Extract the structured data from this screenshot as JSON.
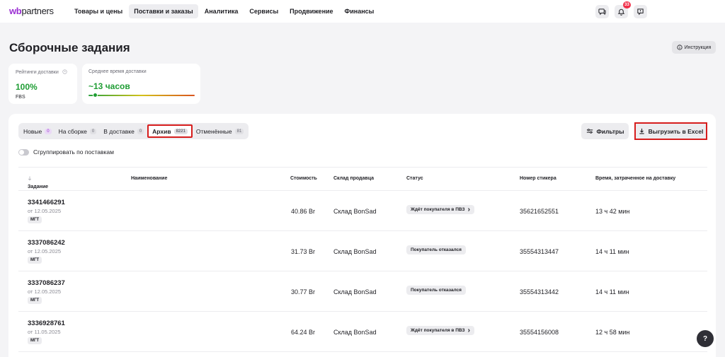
{
  "brand": {
    "wb": "wb",
    "partners": "partners"
  },
  "nav": [
    "Товары и цены",
    "Поставки и заказы",
    "Аналитика",
    "Сервисы",
    "Продвижение",
    "Финансы"
  ],
  "nav_active": "Поставки и заказы",
  "header_icons": {
    "chat": "chat-icon",
    "bell": "bell-icon",
    "bell_badge": "33",
    "feedback": "feedback-icon"
  },
  "page": {
    "title": "Сборочные задания",
    "instruction_label": "Инструкция"
  },
  "rating_card": {
    "label": "Рейтинги доставки",
    "value": "100%",
    "sub": "FBS"
  },
  "delivery_card": {
    "label": "Среднее время доставки",
    "value": "~13 часов"
  },
  "tabs": [
    {
      "label": "Новые",
      "count": "0"
    },
    {
      "label": "На сборке",
      "count": "0"
    },
    {
      "label": "В доставке",
      "count": "0"
    },
    {
      "label": "Архив",
      "count": "8221"
    },
    {
      "label": "Отменённые",
      "count": "81"
    }
  ],
  "active_tab": "Архив",
  "buttons": {
    "filters": "Фильтры",
    "export": "Выгрузить в Excel"
  },
  "group_toggle": "Сгруппировать по поставкам",
  "columns": {
    "task": "Задание",
    "name": "Наименование",
    "price": "Стоимость",
    "warehouse": "Склад продавца",
    "status": "Статус",
    "sticker": "Номер стикера",
    "time": "Время, затраченное на доставку"
  },
  "rows": [
    {
      "id": "3341466291",
      "date": "от 12.05.2025",
      "tag": "МГТ",
      "price": "40.86 Br",
      "warehouse": "Склад BonSad",
      "status": "Ждёт покупателя в ПВЗ",
      "status_arrow": "›",
      "sticker": "35621652551",
      "time": "13 ч 42 мин"
    },
    {
      "id": "3337086242",
      "date": "от 12.05.2025",
      "tag": "МГТ",
      "price": "31.73 Br",
      "warehouse": "Склад BonSad",
      "status": "Покупатель отказался",
      "status_arrow": "",
      "sticker": "35554313447",
      "time": "14 ч 11 мин"
    },
    {
      "id": "3337086237",
      "date": "от 12.05.2025",
      "tag": "МГТ",
      "price": "30.77 Br",
      "warehouse": "Склад BonSad",
      "status": "Покупатель отказался",
      "status_arrow": "",
      "sticker": "35554313442",
      "time": "14 ч 11 мин"
    },
    {
      "id": "3336928761",
      "date": "от 11.05.2025",
      "tag": "МГТ",
      "price": "64.24 Br",
      "warehouse": "Склад BonSad",
      "status": "Ждёт покупателя в ПВЗ",
      "status_arrow": "›",
      "sticker": "35554156008",
      "time": "12 ч 58 мин"
    }
  ],
  "help": "?",
  "colors": {
    "brand": "#9b2fd3",
    "success": "#1f9d34",
    "highlight": "#d61d1d"
  }
}
